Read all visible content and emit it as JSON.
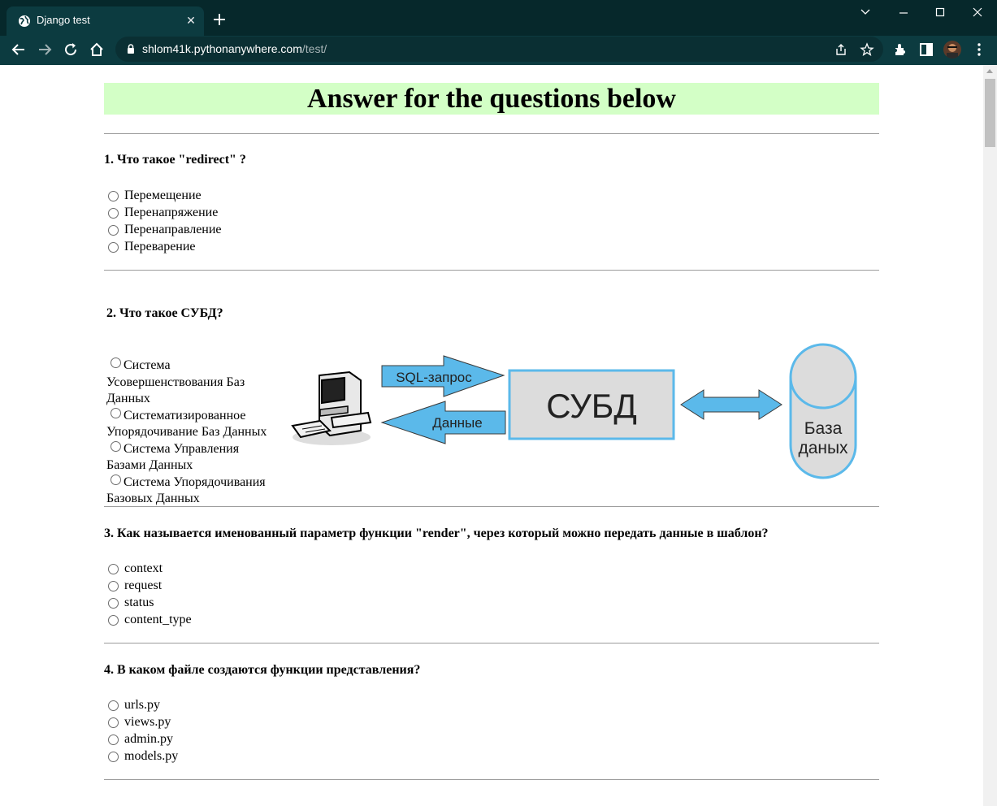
{
  "browser": {
    "tab_title": "Django test",
    "url_host": "shlom41k.pythonanywhere.com",
    "url_path": "/test/"
  },
  "page": {
    "heading": "Answer for the questions below",
    "questions": [
      {
        "title": "1. Что такое \"redirect\" ?",
        "options": [
          "Перемещение",
          "Перенапряжение",
          "Перенаправление",
          "Переварение"
        ]
      },
      {
        "title": "2. Что такое СУБД?",
        "options": [
          [
            "Система",
            "Усовершенствования Баз",
            "Данных"
          ],
          [
            "Систематизированное",
            "Упорядочивание Баз Данных"
          ],
          [
            "Система Управления",
            "Базами Данных"
          ],
          [
            "Система Упорядочивания",
            "Базовых Данных"
          ]
        ],
        "diagram": {
          "arrow_request": "SQL-запрос",
          "arrow_response": "Данные",
          "dbms_label": "СУБД",
          "db_label_line1": "База",
          "db_label_line2": "даных"
        }
      },
      {
        "title": "3. Как называется именованный параметр функции \"render\", через который можно передать данные в шаблон?",
        "options": [
          "context",
          "request",
          "status",
          "content_type"
        ]
      },
      {
        "title": "4. В каком файле создаются функции представления?",
        "options": [
          "urls.py",
          "views.py",
          "admin.py",
          "models.py"
        ]
      }
    ]
  }
}
